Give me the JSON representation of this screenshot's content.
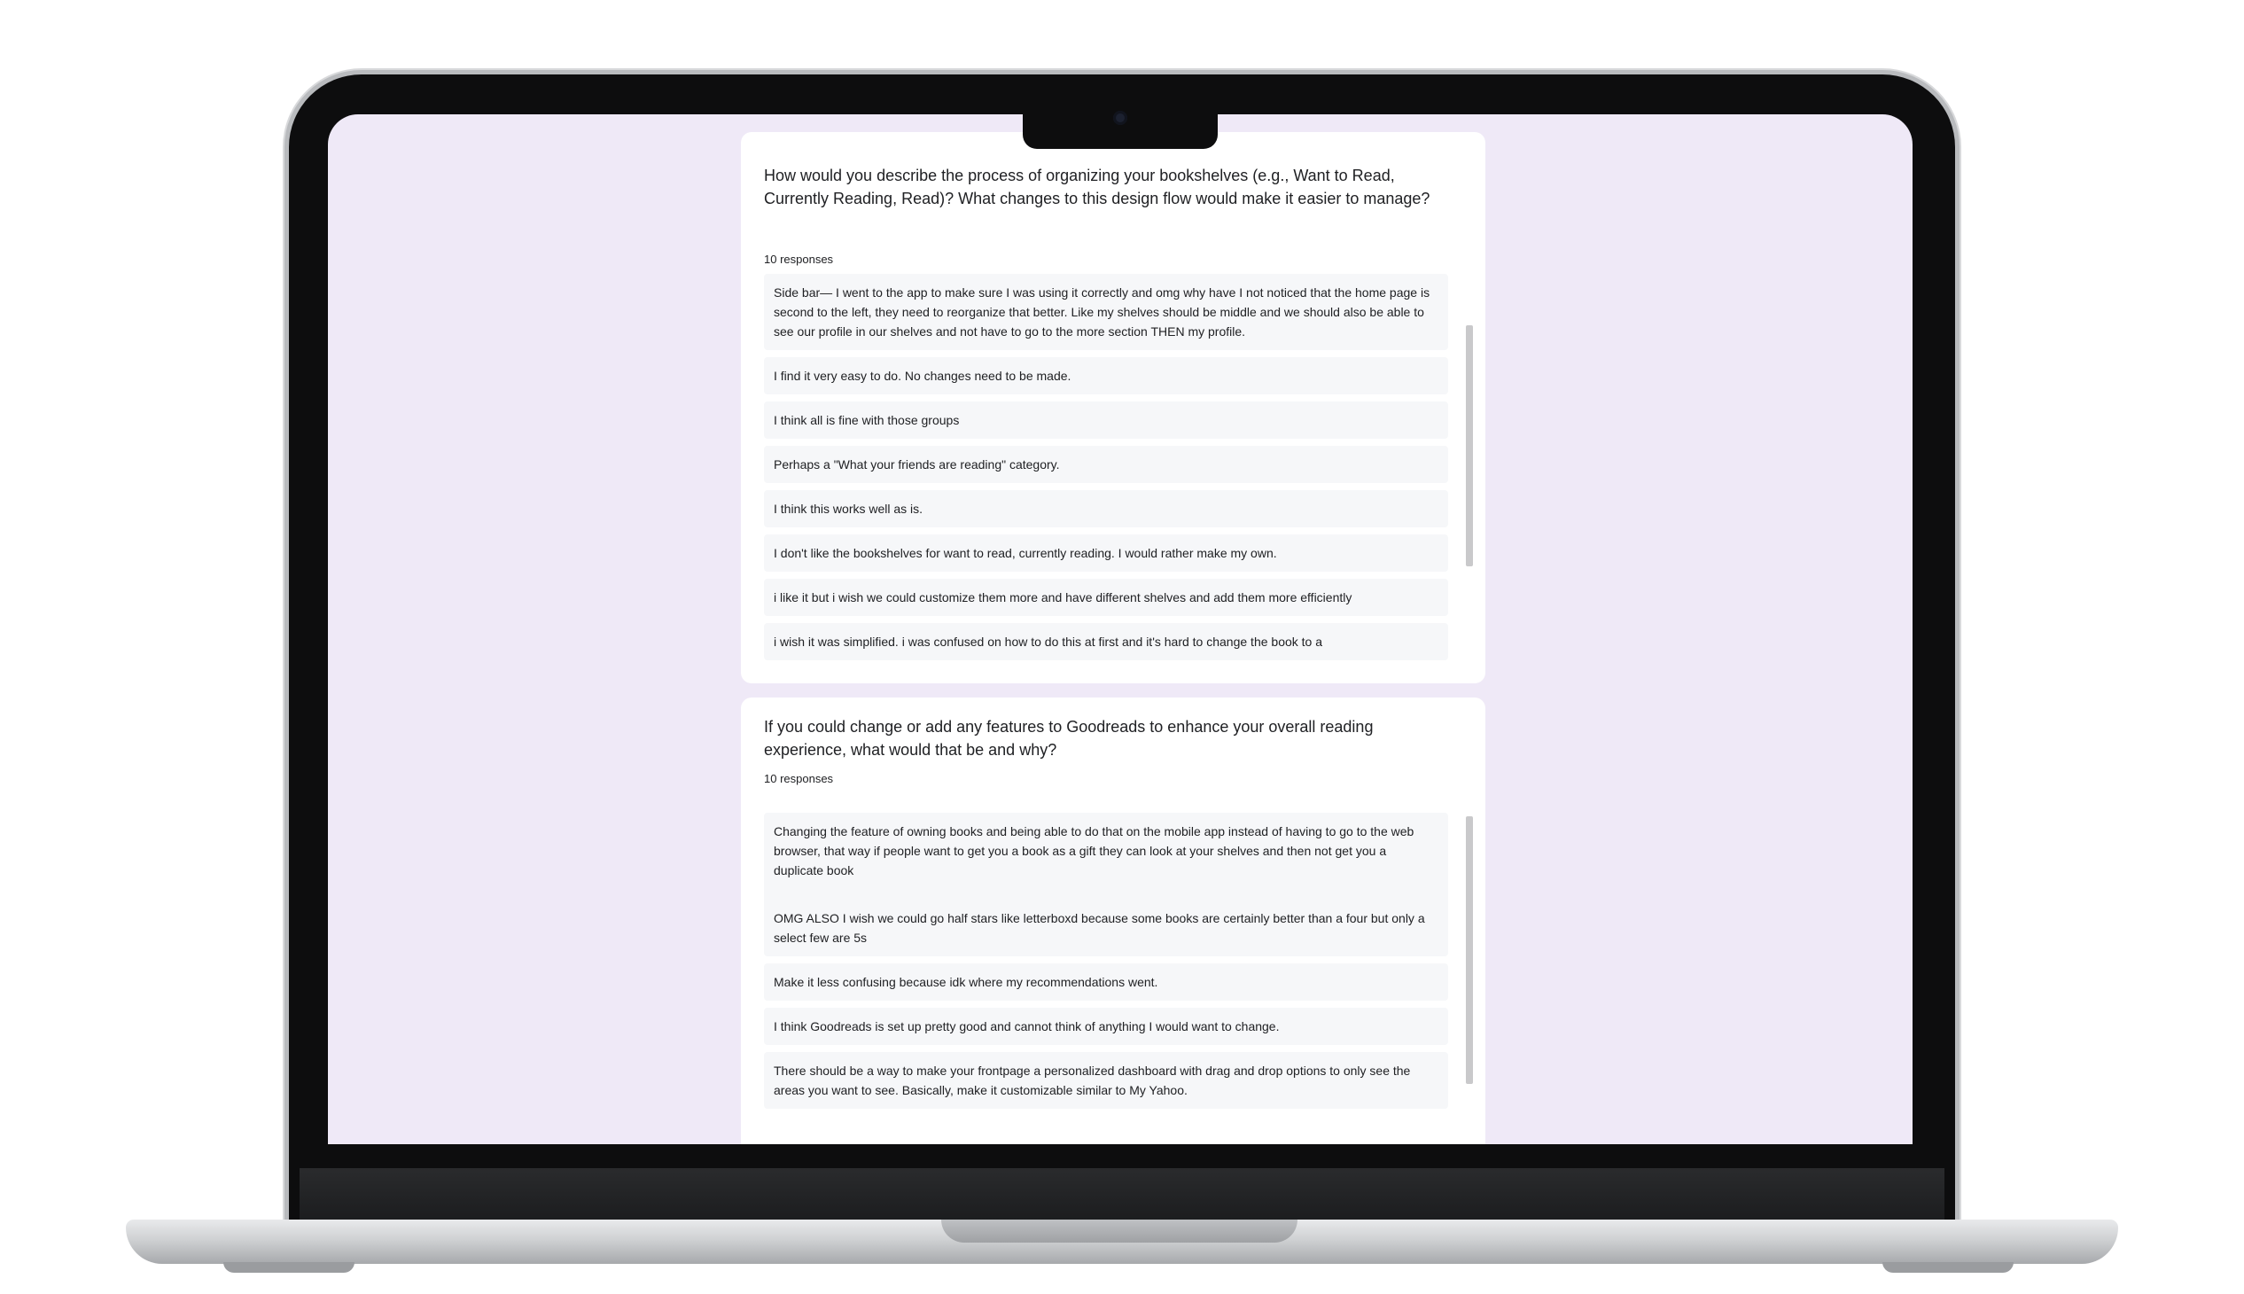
{
  "questions": [
    {
      "title": "How would you describe the process of organizing your bookshelves (e.g., Want to Read, Currently Reading, Read)? What changes to this design flow would make it easier to manage?",
      "response_count": "10 responses",
      "responses": [
        "Side bar— I went to the app to make sure I was using it correctly and omg why have I not noticed that the home page is second to the left, they need to reorganize that better. Like my shelves should be middle and we should also be able to see our profile in our shelves and not have to go to the more section THEN my profile.",
        "I find it very easy to do. No changes need to be made.",
        "I think all is fine with those groups",
        "Perhaps a \"What your friends are reading\" category.",
        "I think this works well as is.",
        "I don't like the bookshelves for want to read, currently reading. I would rather make my own.",
        "i like it but i wish we could customize them more and have different shelves and add them more efficiently",
        "i wish it was simplified. i was confused on how to do this at first and it's hard to change the book to a"
      ]
    },
    {
      "title": "If you could change or add any features to Goodreads to enhance your overall reading experience, what would that be and why?",
      "response_count": "10 responses",
      "responses": [
        "Changing the feature of owning books and being able to do that on the mobile app instead of having to go to the web browser, that way if people want to get you a book as a gift they can look at your shelves and then not get you a duplicate book",
        "OMG ALSO I wish we could go half stars like letterboxd because some books are certainly better than a four but only a select few are 5s",
        "Make it less confusing because idk where my recommendations went.",
        "I think Goodreads is set up pretty good and cannot think of anything I would want to change.",
        "There should be a way to make your frontpage a personalized dashboard with drag and drop options to only see the areas you want to see. Basically, make it customizable similar to My Yahoo."
      ]
    }
  ]
}
